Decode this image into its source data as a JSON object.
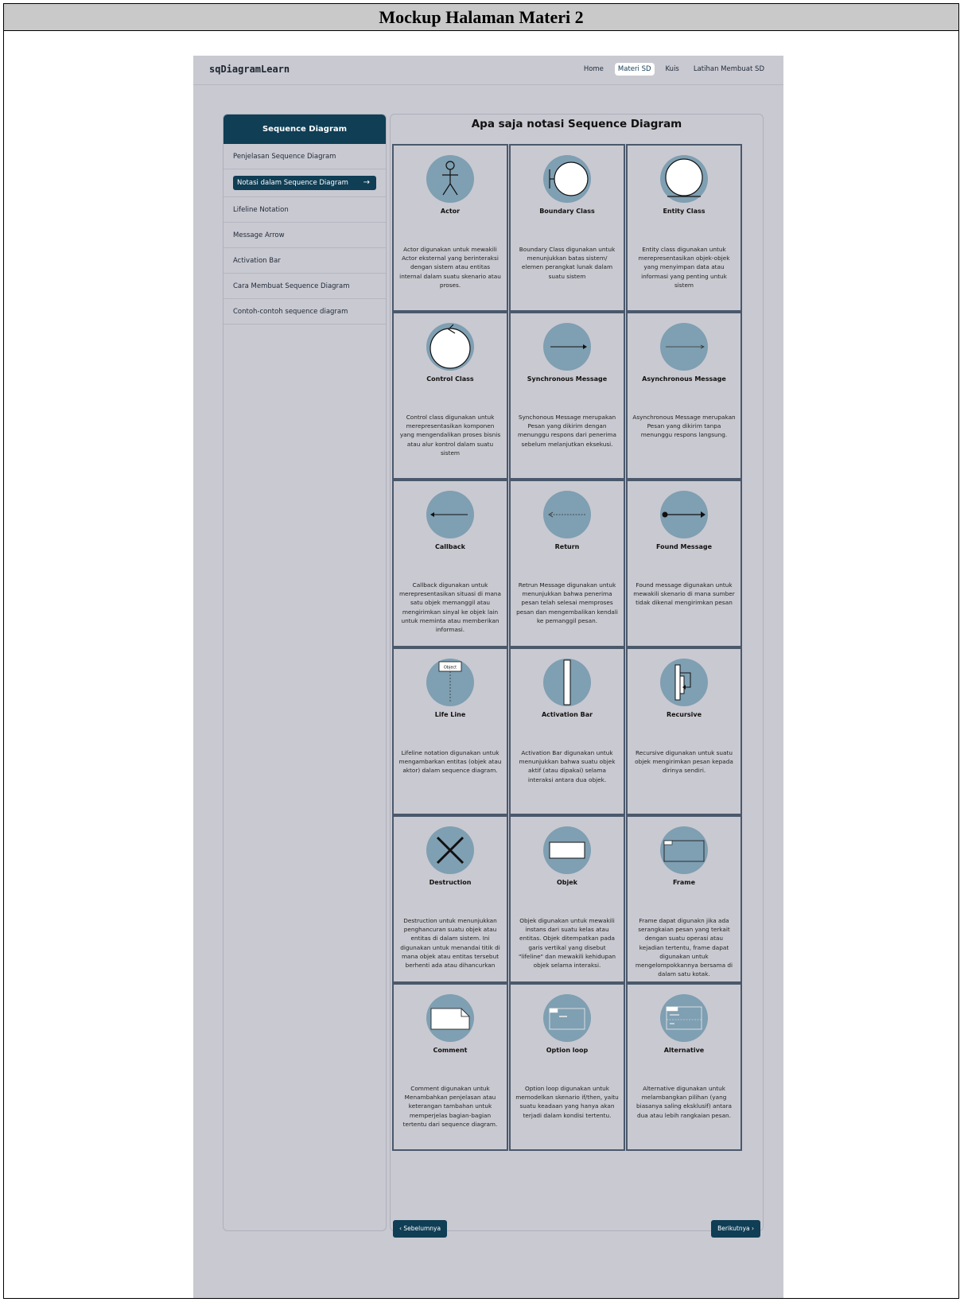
{
  "doc_title": "Mockup Halaman Materi 2",
  "app": {
    "logo": "sqDiagramLearn"
  },
  "nav": [
    "Home",
    "Materi SD",
    "Kuis",
    "Latihan Membuat SD"
  ],
  "sidebar": {
    "title": "Sequence Diagram",
    "items": [
      "Penjelasan Sequence Diagram",
      "Notasi dalam Sequence Diagram",
      "Lifeline Notation",
      "Message Arrow",
      "Activation Bar",
      "Cara Membuat Sequence Diagram",
      "Contoh-contoh sequence diagram"
    ],
    "active_arrow": "→"
  },
  "content": {
    "title": "Apa saja notasi Sequence Diagram",
    "cards": [
      {
        "name": "Actor",
        "desc": "Actor digunakan untuk mewakili Actor eksternal yang berinteraksi dengan sistem atau entitas internal dalam suatu skenario atau proses."
      },
      {
        "name": "Boundary Class",
        "desc": "Boundary Class digunakan untuk menunjukkan batas sistem/ elemen perangkat lunak dalam suatu sistem"
      },
      {
        "name": "Entity Class",
        "desc": "Entity class digunakan untuk merepresentasikan objek-objek yang menyimpan data atau informasi yang penting untuk sistem"
      },
      {
        "name": "Control Class",
        "desc": "Control class digunakan untuk merepresentasikan komponen yang mengendalikan proses bisnis atau alur kontrol dalam suatu sistem"
      },
      {
        "name": "Synchronous Message",
        "desc": "Synchonous Message merupakan Pesan yang dikirim dengan menunggu respons dari penerima sebelum melanjutkan eksekusi."
      },
      {
        "name": "Asynchronous Message",
        "desc": "Asynchronous Message merupakan Pesan yang dikirim tanpa menunggu respons langsung."
      },
      {
        "name": "Callback",
        "desc": "Callback digunakan untuk merepresentasikan situasi di mana satu objek memanggil atau mengirimkan sinyal ke objek lain untuk meminta atau memberikan informasi."
      },
      {
        "name": "Return",
        "desc": "Retrun Message digunakan untuk menunjukkan bahwa penerima pesan telah selesai memproses pesan dan mengembalikan kendali ke pemanggil pesan."
      },
      {
        "name": "Found Message",
        "desc": "Found message digunakan untuk mewakili skenario di mana sumber tidak dikenal mengirimkan pesan"
      },
      {
        "name": "Life Line",
        "desc": "Lifeline notation digunakan untuk mengambarkan entitas (objek atau aktor) dalam sequence diagram."
      },
      {
        "name": "Activation Bar",
        "desc": "Activation Bar digunakan untuk menunjukkan bahwa suatu objek aktif (atau dipakai) selama interaksi antara dua objek."
      },
      {
        "name": "Recursive",
        "desc": "Recursive digunakan untuk suatu objek mengirimkan pesan kepada dirinya sendiri."
      },
      {
        "name": "Destruction",
        "desc": "Destruction untuk menunjukkan penghancuran suatu objek atau entitas di dalam sistem. Ini digunakan untuk menandai titik di mana objek atau entitas tersebut berhenti ada atau dihancurkan"
      },
      {
        "name": "Objek",
        "desc": "Objek digunakan untuk mewakili instans dari suatu kelas atau entitas. Objek ditempatkan pada garis vertikal yang disebut \"lifeline\" dan mewakili kehidupan objek selama interaksi."
      },
      {
        "name": "Frame",
        "desc": "Frame dapat digunakn jika ada serangkaian pesan yang terkait dengan suatu operasi atau kejadian tertentu, frame dapat digunakan untuk mengelompokkannya bersama di dalam satu kotak."
      },
      {
        "name": "Comment",
        "desc": "Comment digunakan untuk Menambahkan penjelasan atau keterangan tambahan untuk memperjelas bagian-bagian tertentu dari sequence diagram."
      },
      {
        "name": "Option loop",
        "desc": "Option loop digunakan untuk memodelkan skenario if/then, yaitu suatu keadaan yang hanya akan terjadi dalam kondisi tertentu."
      },
      {
        "name": "Alternative",
        "desc": "Alternative digunakan untuk melambangkan pilihan (yang biasanya saling eksklusif) antara dua atau lebih rangkaian pesan."
      }
    ],
    "icon_labels": {
      "object": "Object"
    }
  },
  "buttons": {
    "prev": "‹  Sebelumnya",
    "next": "Berikutnya  ›"
  }
}
